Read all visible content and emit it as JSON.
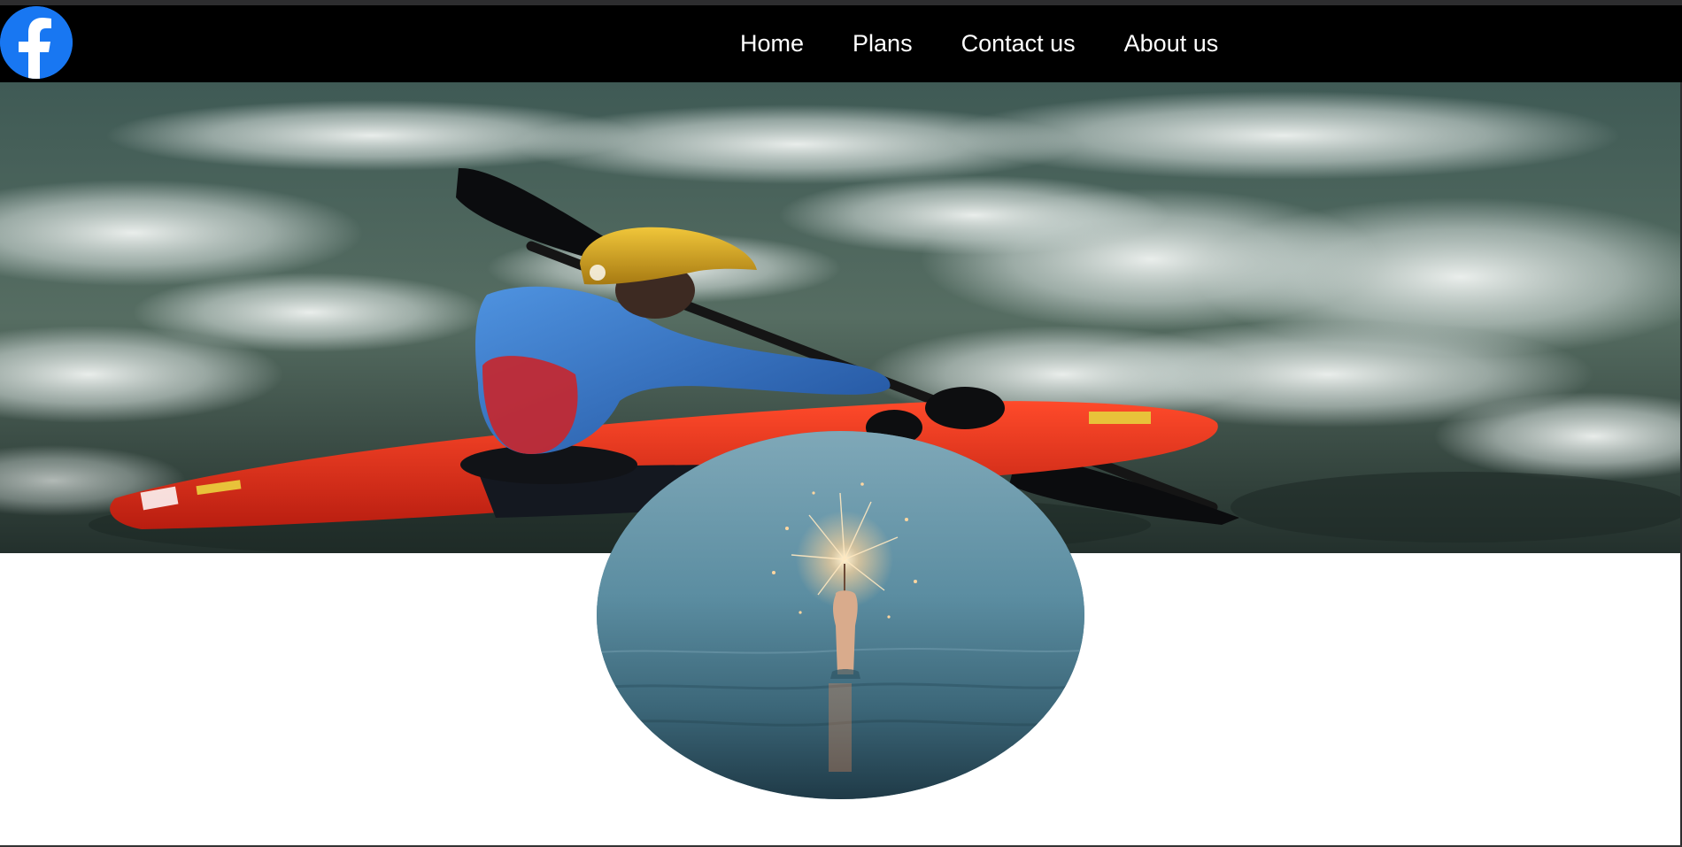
{
  "brand": {
    "logo_icon": "facebook-icon",
    "logo_color": "#1877f2"
  },
  "nav": {
    "items": [
      {
        "label": "Home"
      },
      {
        "label": "Plans"
      },
      {
        "label": "Contact us"
      },
      {
        "label": "About us"
      }
    ]
  },
  "hero": {
    "image": "whitewater-kayaker-photo",
    "kayak_color": "#f0341f",
    "helmet_color": "#d9a520",
    "jacket_color": "#2d6fc4"
  },
  "feature": {
    "image": "hand-holding-sparkler-in-water-photo"
  }
}
